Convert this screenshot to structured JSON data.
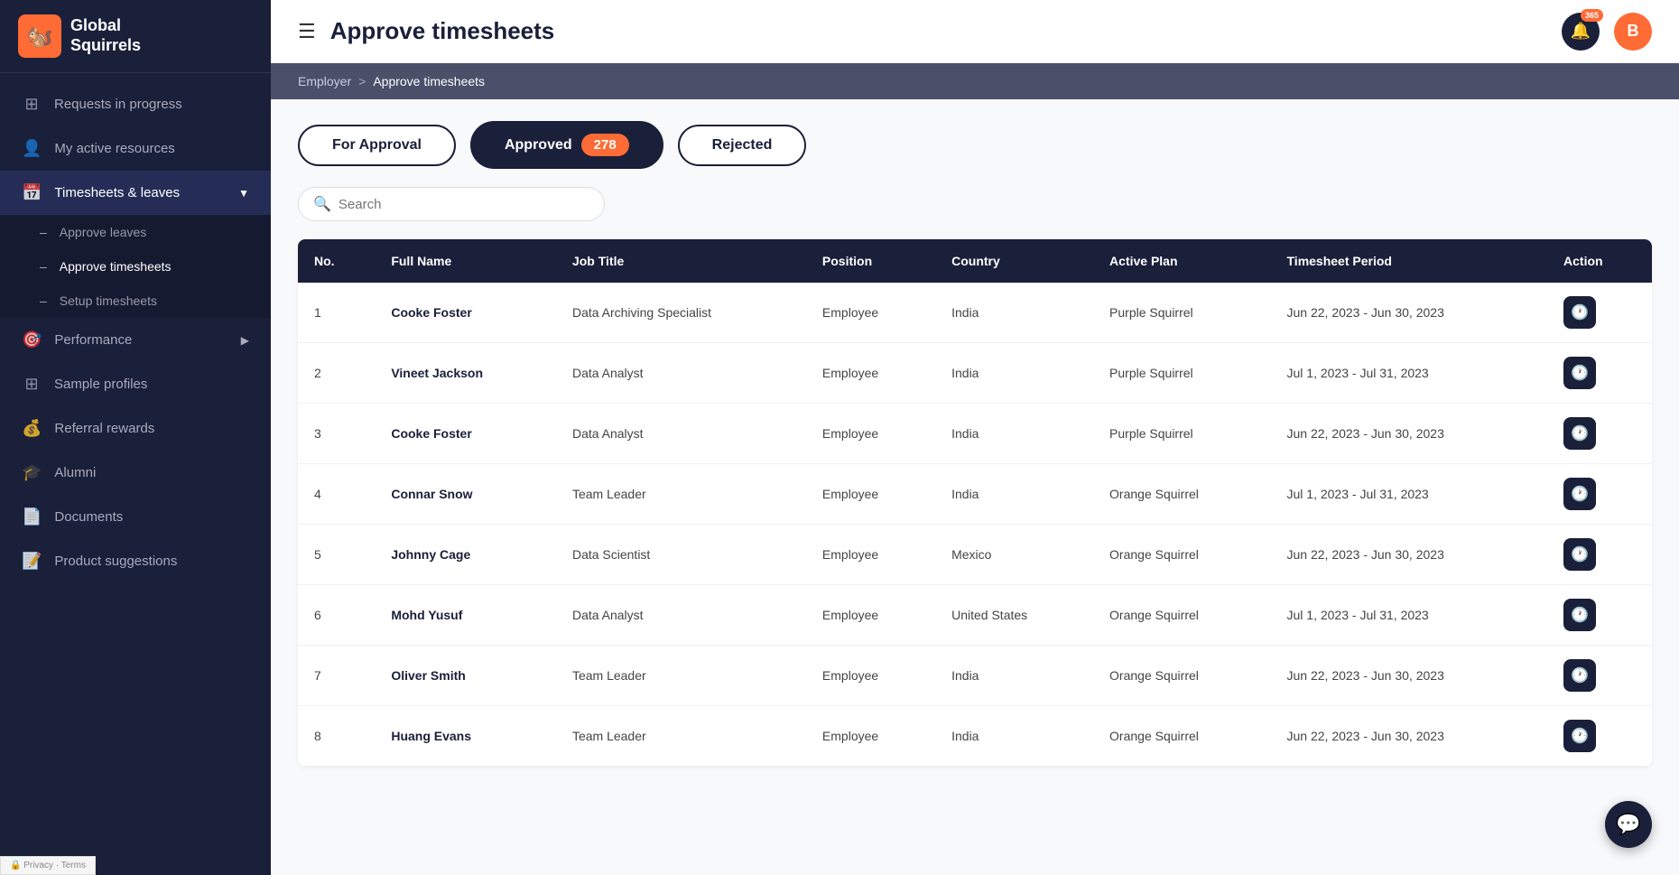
{
  "app": {
    "name": "Global Squirrels",
    "logo_emoji": "🐿️"
  },
  "topbar": {
    "title": "Approve timesheets",
    "hamburger_label": "☰",
    "notification_count": "365",
    "user_initial": "B"
  },
  "breadcrumb": {
    "employer": "Employer",
    "separator": ">",
    "current": "Approve timesheets"
  },
  "tabs": [
    {
      "id": "for-approval",
      "label": "For Approval",
      "active": false,
      "count": null
    },
    {
      "id": "approved",
      "label": "Approved",
      "active": true,
      "count": "278"
    },
    {
      "id": "rejected",
      "label": "Rejected",
      "active": false,
      "count": null
    }
  ],
  "search": {
    "placeholder": "Search"
  },
  "table": {
    "headers": [
      "No.",
      "Full Name",
      "Job Title",
      "Position",
      "Country",
      "Active Plan",
      "Timesheet Period",
      "Action"
    ],
    "rows": [
      {
        "no": 1,
        "name": "Cooke Foster",
        "job_title": "Data Archiving Specialist",
        "position": "Employee",
        "country": "India",
        "active_plan": "Purple Squirrel",
        "period": "Jun 22, 2023 - Jun 30, 2023"
      },
      {
        "no": 2,
        "name": "Vineet Jackson",
        "job_title": "Data Analyst",
        "position": "Employee",
        "country": "India",
        "active_plan": "Purple Squirrel",
        "period": "Jul 1, 2023 - Jul 31, 2023"
      },
      {
        "no": 3,
        "name": "Cooke Foster",
        "job_title": "Data Analyst",
        "position": "Employee",
        "country": "India",
        "active_plan": "Purple Squirrel",
        "period": "Jun 22, 2023 - Jun 30, 2023"
      },
      {
        "no": 4,
        "name": "Connar Snow",
        "job_title": "Team Leader",
        "position": "Employee",
        "country": "India",
        "active_plan": "Orange Squirrel",
        "period": "Jul 1, 2023 - Jul 31, 2023"
      },
      {
        "no": 5,
        "name": "Johnny Cage",
        "job_title": "Data Scientist",
        "position": "Employee",
        "country": "Mexico",
        "active_plan": "Orange Squirrel",
        "period": "Jun 22, 2023 - Jun 30, 2023"
      },
      {
        "no": 6,
        "name": "Mohd Yusuf",
        "job_title": "Data Analyst",
        "position": "Employee",
        "country": "United States",
        "active_plan": "Orange Squirrel",
        "period": "Jul 1, 2023 - Jul 31, 2023"
      },
      {
        "no": 7,
        "name": "Oliver Smith",
        "job_title": "Team Leader",
        "position": "Employee",
        "country": "India",
        "active_plan": "Orange Squirrel",
        "period": "Jun 22, 2023 - Jun 30, 2023"
      },
      {
        "no": 8,
        "name": "Huang Evans",
        "job_title": "Team Leader",
        "position": "Employee",
        "country": "India",
        "active_plan": "Orange Squirrel",
        "period": "Jun 22, 2023 - Jun 30, 2023"
      }
    ]
  },
  "sidebar": {
    "nav_items": [
      {
        "id": "requests",
        "label": "Requests in progress",
        "icon": "⊞"
      },
      {
        "id": "resources",
        "label": "My active resources",
        "icon": "👤"
      },
      {
        "id": "timesheets",
        "label": "Timesheets & leaves",
        "icon": "📅",
        "expanded": true
      },
      {
        "id": "performance",
        "label": "Performance",
        "icon": "🎯"
      },
      {
        "id": "sample",
        "label": "Sample profiles",
        "icon": "⊞"
      },
      {
        "id": "referral",
        "label": "Referral rewards",
        "icon": "💰"
      },
      {
        "id": "alumni",
        "label": "Alumni",
        "icon": "🎓"
      },
      {
        "id": "documents",
        "label": "Documents",
        "icon": "📄"
      },
      {
        "id": "product",
        "label": "Product suggestions",
        "icon": "📝"
      }
    ],
    "sub_items": [
      {
        "id": "approve-leaves",
        "label": "Approve leaves"
      },
      {
        "id": "approve-timesheets",
        "label": "Approve timesheets",
        "active": true
      },
      {
        "id": "setup-timesheets",
        "label": "Setup timesheets"
      }
    ]
  }
}
